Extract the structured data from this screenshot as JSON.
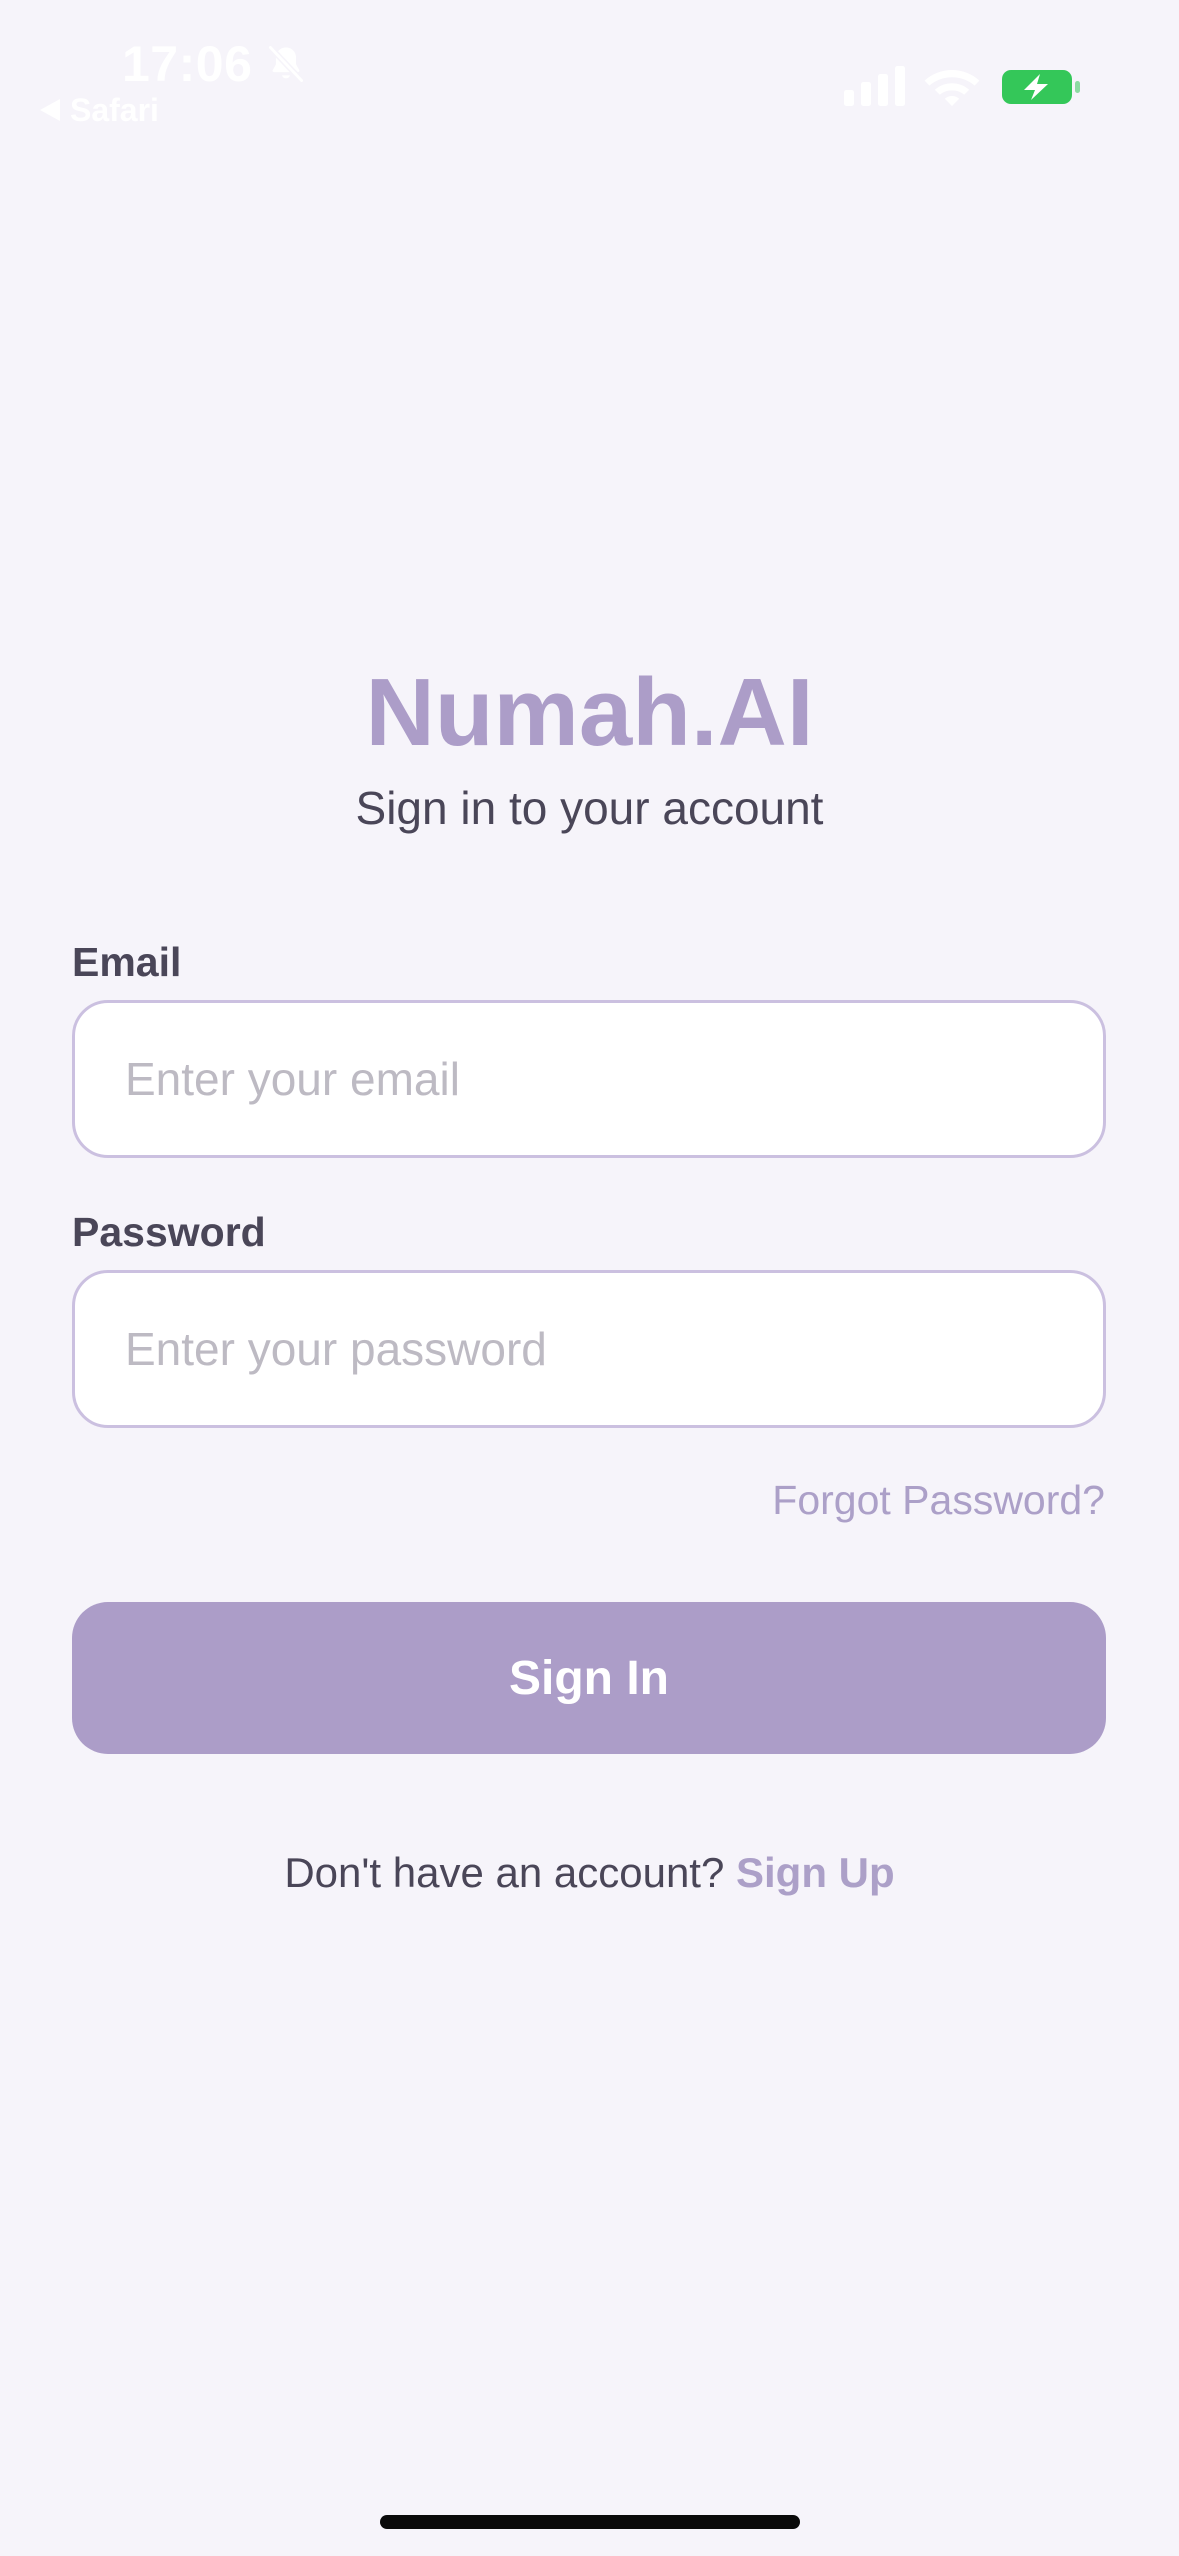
{
  "status_bar": {
    "time": "17:06",
    "back_label": "Safari",
    "icons": {
      "bell": "bell-slash-icon",
      "signal": "cellular-signal-icon",
      "wifi": "wifi-icon",
      "battery": "battery-charging-icon"
    },
    "colors": {
      "battery": "#34C759",
      "text": "#FFFFFF"
    }
  },
  "header": {
    "title": "Numah.AI",
    "subtitle": "Sign in to your account"
  },
  "form": {
    "email": {
      "label": "Email",
      "value": "",
      "placeholder": "Enter your email"
    },
    "password": {
      "label": "Password",
      "value": "",
      "placeholder": "Enter your password"
    },
    "forgot_password": "Forgot Password?",
    "submit_label": "Sign In"
  },
  "footer": {
    "prompt": "Don't have an account?",
    "signup_label": "Sign Up"
  },
  "colors": {
    "background": "#F6F4FA",
    "accent": "#AC9DC8",
    "text": "#4A4658",
    "input_border": "#CBC0E0",
    "placeholder": "#BDBAC3"
  }
}
